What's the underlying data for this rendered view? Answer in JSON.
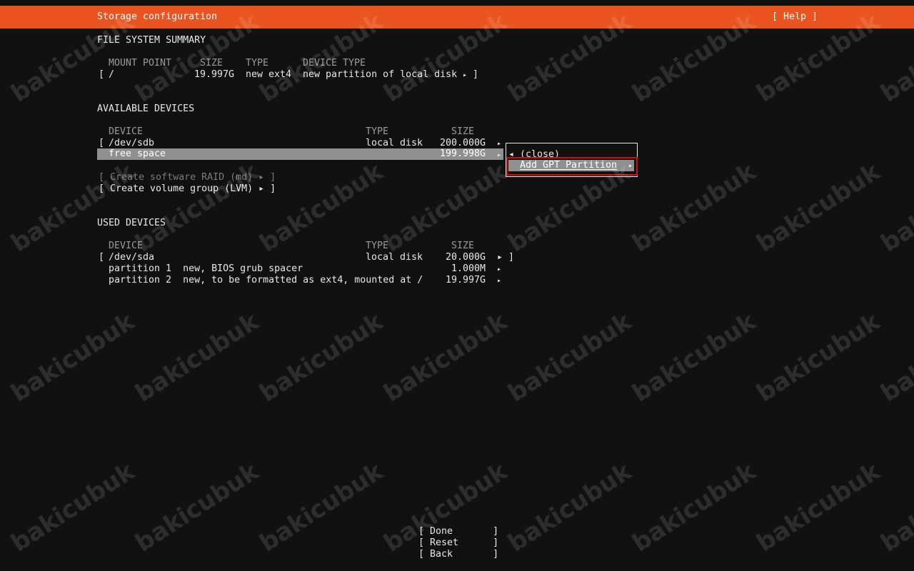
{
  "header": {
    "title": "Storage configuration",
    "help": "[ Help ]"
  },
  "fs_summary": {
    "heading": "FILE SYSTEM SUMMARY",
    "columns": {
      "mount_point": "MOUNT POINT",
      "size": "SIZE",
      "type": "TYPE",
      "device_type": "DEVICE TYPE"
    },
    "rows": [
      {
        "open": "[",
        "mount": "/",
        "size": "19.997G",
        "type": "new ext4",
        "device_type": "new partition of local disk",
        "close": "]"
      }
    ]
  },
  "available": {
    "heading": "AVAILABLE DEVICES",
    "columns": {
      "device": "DEVICE",
      "type": "TYPE",
      "size": "SIZE"
    },
    "disk": {
      "open": "[",
      "name": "/dev/sdb",
      "type": "local disk",
      "size": "200.000G"
    },
    "free": {
      "name": "free space",
      "size": "199.998G"
    },
    "raid": "[ Create software RAID (md) ▸ ]",
    "lvm": "[ Create volume group (LVM) ▸ ]"
  },
  "context_menu": {
    "close": "◂ (close)",
    "add_gpt": "Add GPT Partition",
    "arrow": "▸"
  },
  "used": {
    "heading": "USED DEVICES",
    "columns": {
      "device": "DEVICE",
      "type": "TYPE",
      "size": "SIZE"
    },
    "disk": {
      "open": "[",
      "name": "/dev/sda",
      "type": "local disk",
      "size": "20.000G",
      "close": "▸ ]"
    },
    "partitions": [
      {
        "label": "partition 1  new, BIOS grub spacer",
        "size": "1.000M"
      },
      {
        "label": "partition 2  new, to be formatted as ext4, mounted at /",
        "size": "19.997G"
      }
    ]
  },
  "footer": {
    "done": "[ Done       ]",
    "reset": "[ Reset      ]",
    "back": "[ Back       ]"
  },
  "watermark": "bakicubuk",
  "colors": {
    "accent": "#e95420",
    "background": "#111111",
    "highlight": "#8f8f8f",
    "annotation": "#d01010"
  },
  "arrow_glyph": "▸"
}
